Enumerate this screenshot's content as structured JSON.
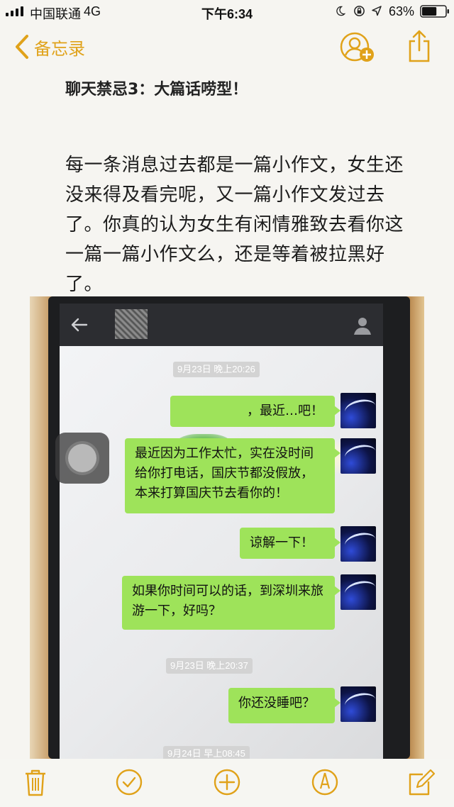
{
  "status_bar": {
    "carrier": "中国联通",
    "network": "4G",
    "time": "下午6:34",
    "battery": "63%",
    "battery_level": 0.63,
    "icons": [
      "signal-icon",
      "moon-icon",
      "orientation-lock-icon",
      "location-icon",
      "battery-icon"
    ]
  },
  "nav": {
    "back_label": "备忘录",
    "back_icon": "chevron-left-icon",
    "add_person_icon": "add-person-icon",
    "share_icon": "share-icon",
    "accent_color": "#e0a21a"
  },
  "note": {
    "title": "聊天禁忌3：大篇话唠型！",
    "body": "每一条消息过去都是一篇小作文，女生还没来得及看完呢，又一篇小作文发过去了。你真的认为女生有闲情雅致去看你这一篇一篇小作文么，还是等着被拉黑好了。"
  },
  "chat_photo": {
    "timestamps": [
      "9月23日 晚上20:26",
      "9月23日 晚上20:37",
      "9月24日 早上08:45"
    ],
    "messages": [
      {
        "text": "，最近…吧！"
      },
      {
        "text": "最近因为工作太忙，实在没时间给你打电话，国庆节都没假放，本来打算国庆节去看你的！"
      },
      {
        "text": "谅解一下！"
      },
      {
        "text": "如果你时间可以的话，到深圳来旅游一下，好吗？"
      },
      {
        "text": "你还没睡吧？"
      }
    ],
    "bubble_color": "#9ee35a"
  },
  "toolbar": {
    "icons": [
      "trash-icon",
      "checklist-icon",
      "add-icon",
      "markup-icon",
      "compose-icon"
    ]
  }
}
